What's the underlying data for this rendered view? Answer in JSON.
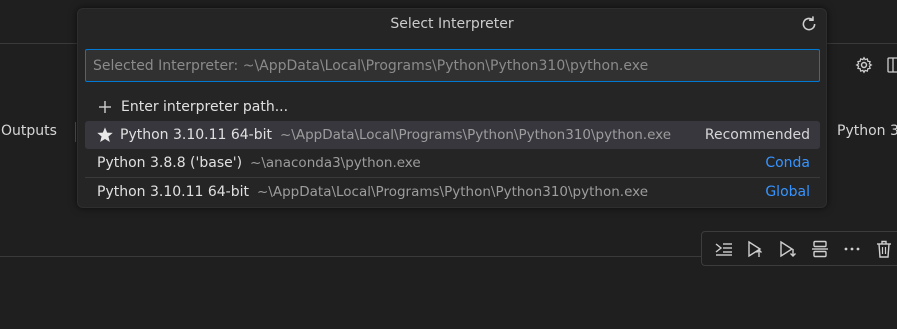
{
  "background": {
    "left_tab": "Outputs",
    "right_kernel": "Python 3"
  },
  "picker": {
    "title": "Select Interpreter",
    "input_placeholder": "Selected Interpreter: ~\\AppData\\Local\\Programs\\Python\\Python310\\python.exe",
    "enter_path_label": "Enter interpreter path...",
    "items": [
      {
        "label": "Python 3.10.11 64-bit",
        "path": "~\\AppData\\Local\\Programs\\Python\\Python310\\python.exe",
        "tag": "Recommended",
        "icon": "star-icon"
      },
      {
        "label": "Python 3.8.8 ('base')",
        "path": "~\\anaconda3\\python.exe",
        "tag": "Conda"
      },
      {
        "label": "Python 3.10.11 64-bit",
        "path": "~\\AppData\\Local\\Programs\\Python\\Python310\\python.exe",
        "tag": "Global"
      }
    ]
  },
  "colors": {
    "accent_border": "#0078d4",
    "link": "#3794ff",
    "active_row": "#37373d"
  },
  "cell_toolbar_icons": [
    "run-by-line-icon",
    "execute-above-icon",
    "execute-below-icon",
    "split-cell-icon",
    "more-icon",
    "delete-icon"
  ]
}
